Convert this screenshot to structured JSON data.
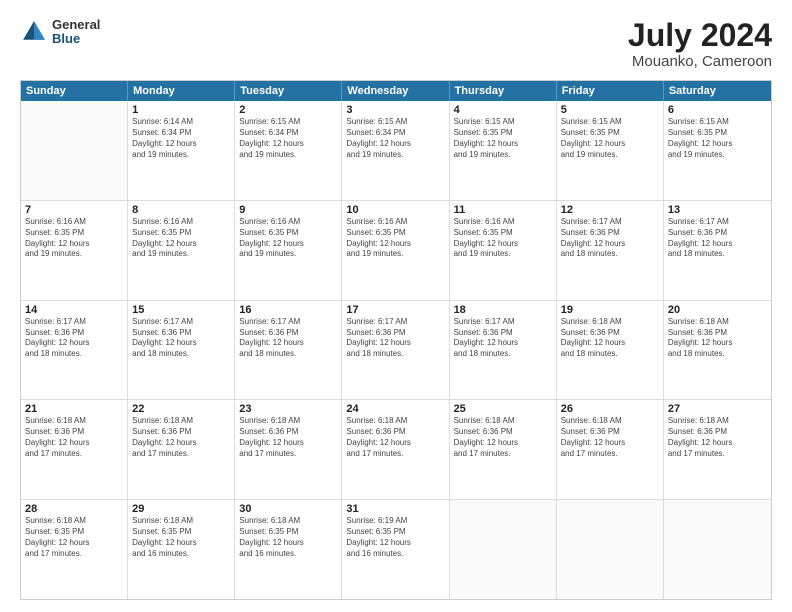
{
  "logo": {
    "general": "General",
    "blue": "Blue"
  },
  "header": {
    "title": "July 2024",
    "subtitle": "Mouanko, Cameroon"
  },
  "calendar": {
    "days_of_week": [
      "Sunday",
      "Monday",
      "Tuesday",
      "Wednesday",
      "Thursday",
      "Friday",
      "Saturday"
    ],
    "weeks": [
      [
        {
          "day": "",
          "info": ""
        },
        {
          "day": "1",
          "info": "Sunrise: 6:14 AM\nSunset: 6:34 PM\nDaylight: 12 hours\nand 19 minutes."
        },
        {
          "day": "2",
          "info": "Sunrise: 6:15 AM\nSunset: 6:34 PM\nDaylight: 12 hours\nand 19 minutes."
        },
        {
          "day": "3",
          "info": "Sunrise: 6:15 AM\nSunset: 6:34 PM\nDaylight: 12 hours\nand 19 minutes."
        },
        {
          "day": "4",
          "info": "Sunrise: 6:15 AM\nSunset: 6:35 PM\nDaylight: 12 hours\nand 19 minutes."
        },
        {
          "day": "5",
          "info": "Sunrise: 6:15 AM\nSunset: 6:35 PM\nDaylight: 12 hours\nand 19 minutes."
        },
        {
          "day": "6",
          "info": "Sunrise: 6:15 AM\nSunset: 6:35 PM\nDaylight: 12 hours\nand 19 minutes."
        }
      ],
      [
        {
          "day": "7",
          "info": "Sunrise: 6:16 AM\nSunset: 6:35 PM\nDaylight: 12 hours\nand 19 minutes."
        },
        {
          "day": "8",
          "info": "Sunrise: 6:16 AM\nSunset: 6:35 PM\nDaylight: 12 hours\nand 19 minutes."
        },
        {
          "day": "9",
          "info": "Sunrise: 6:16 AM\nSunset: 6:35 PM\nDaylight: 12 hours\nand 19 minutes."
        },
        {
          "day": "10",
          "info": "Sunrise: 6:16 AM\nSunset: 6:35 PM\nDaylight: 12 hours\nand 19 minutes."
        },
        {
          "day": "11",
          "info": "Sunrise: 6:16 AM\nSunset: 6:35 PM\nDaylight: 12 hours\nand 19 minutes."
        },
        {
          "day": "12",
          "info": "Sunrise: 6:17 AM\nSunset: 6:36 PM\nDaylight: 12 hours\nand 18 minutes."
        },
        {
          "day": "13",
          "info": "Sunrise: 6:17 AM\nSunset: 6:36 PM\nDaylight: 12 hours\nand 18 minutes."
        }
      ],
      [
        {
          "day": "14",
          "info": "Sunrise: 6:17 AM\nSunset: 6:36 PM\nDaylight: 12 hours\nand 18 minutes."
        },
        {
          "day": "15",
          "info": "Sunrise: 6:17 AM\nSunset: 6:36 PM\nDaylight: 12 hours\nand 18 minutes."
        },
        {
          "day": "16",
          "info": "Sunrise: 6:17 AM\nSunset: 6:36 PM\nDaylight: 12 hours\nand 18 minutes."
        },
        {
          "day": "17",
          "info": "Sunrise: 6:17 AM\nSunset: 6:36 PM\nDaylight: 12 hours\nand 18 minutes."
        },
        {
          "day": "18",
          "info": "Sunrise: 6:17 AM\nSunset: 6:36 PM\nDaylight: 12 hours\nand 18 minutes."
        },
        {
          "day": "19",
          "info": "Sunrise: 6:18 AM\nSunset: 6:36 PM\nDaylight: 12 hours\nand 18 minutes."
        },
        {
          "day": "20",
          "info": "Sunrise: 6:18 AM\nSunset: 6:36 PM\nDaylight: 12 hours\nand 18 minutes."
        }
      ],
      [
        {
          "day": "21",
          "info": "Sunrise: 6:18 AM\nSunset: 6:36 PM\nDaylight: 12 hours\nand 17 minutes."
        },
        {
          "day": "22",
          "info": "Sunrise: 6:18 AM\nSunset: 6:36 PM\nDaylight: 12 hours\nand 17 minutes."
        },
        {
          "day": "23",
          "info": "Sunrise: 6:18 AM\nSunset: 6:36 PM\nDaylight: 12 hours\nand 17 minutes."
        },
        {
          "day": "24",
          "info": "Sunrise: 6:18 AM\nSunset: 6:36 PM\nDaylight: 12 hours\nand 17 minutes."
        },
        {
          "day": "25",
          "info": "Sunrise: 6:18 AM\nSunset: 6:36 PM\nDaylight: 12 hours\nand 17 minutes."
        },
        {
          "day": "26",
          "info": "Sunrise: 6:18 AM\nSunset: 6:36 PM\nDaylight: 12 hours\nand 17 minutes."
        },
        {
          "day": "27",
          "info": "Sunrise: 6:18 AM\nSunset: 6:36 PM\nDaylight: 12 hours\nand 17 minutes."
        }
      ],
      [
        {
          "day": "28",
          "info": "Sunrise: 6:18 AM\nSunset: 6:35 PM\nDaylight: 12 hours\nand 17 minutes."
        },
        {
          "day": "29",
          "info": "Sunrise: 6:18 AM\nSunset: 6:35 PM\nDaylight: 12 hours\nand 16 minutes."
        },
        {
          "day": "30",
          "info": "Sunrise: 6:18 AM\nSunset: 6:35 PM\nDaylight: 12 hours\nand 16 minutes."
        },
        {
          "day": "31",
          "info": "Sunrise: 6:19 AM\nSunset: 6:35 PM\nDaylight: 12 hours\nand 16 minutes."
        },
        {
          "day": "",
          "info": ""
        },
        {
          "day": "",
          "info": ""
        },
        {
          "day": "",
          "info": ""
        }
      ]
    ]
  }
}
